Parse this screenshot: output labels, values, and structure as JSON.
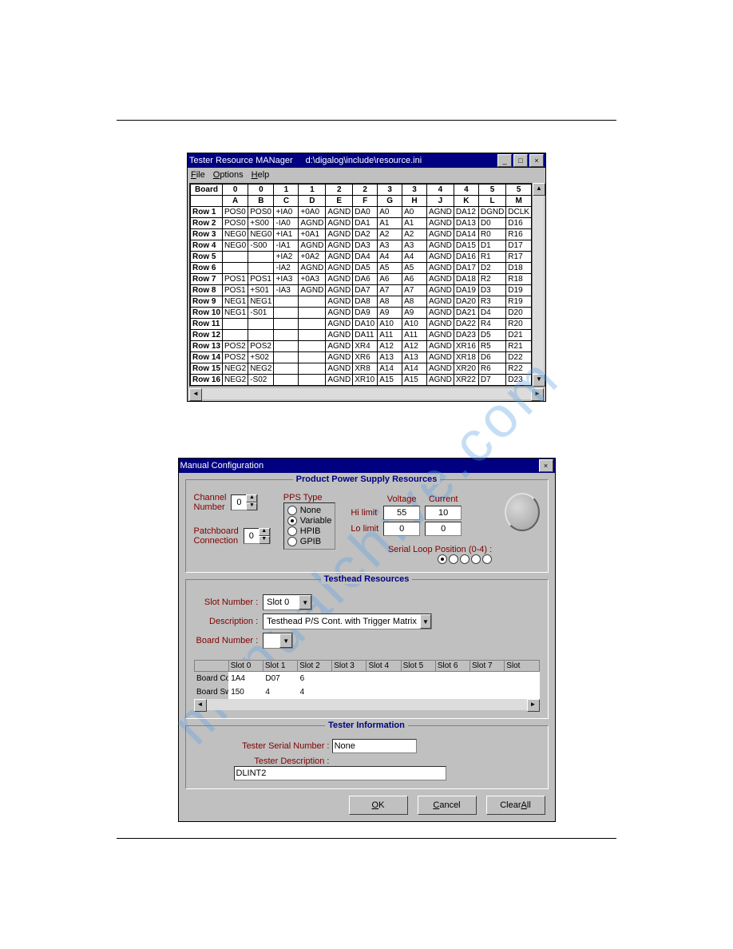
{
  "win1": {
    "title_app": "Tester Resource MANager",
    "title_path": "d:\\digalog\\include\\resource.ini",
    "menus": [
      "File",
      "Options",
      "Help"
    ],
    "header1": [
      "Board",
      "0",
      "0",
      "1",
      "1",
      "2",
      "2",
      "3",
      "3",
      "4",
      "4",
      "5",
      "5"
    ],
    "header2": [
      "",
      "A",
      "B",
      "C",
      "D",
      "E",
      "F",
      "G",
      "H",
      "J",
      "K",
      "L",
      "M"
    ],
    "rows": [
      [
        "Row 1",
        "POS0",
        "POS0",
        "+IA0",
        "+0A0",
        "AGND",
        "DA0",
        "A0",
        "A0",
        "AGND",
        "DA12",
        "DGND",
        "DCLK"
      ],
      [
        "Row 2",
        "POS0",
        "+S00",
        "-IA0",
        "AGND",
        "AGND",
        "DA1",
        "A1",
        "A1",
        "AGND",
        "DA13",
        "D0",
        "D16"
      ],
      [
        "Row 3",
        "NEG0",
        "NEG0",
        "+IA1",
        "+0A1",
        "AGND",
        "DA2",
        "A2",
        "A2",
        "AGND",
        "DA14",
        "R0",
        "R16"
      ],
      [
        "Row 4",
        "NEG0",
        "-S00",
        "-IA1",
        "AGND",
        "AGND",
        "DA3",
        "A3",
        "A3",
        "AGND",
        "DA15",
        "D1",
        "D17"
      ],
      [
        "Row 5",
        "",
        "",
        "+IA2",
        "+0A2",
        "AGND",
        "DA4",
        "A4",
        "A4",
        "AGND",
        "DA16",
        "R1",
        "R17"
      ],
      [
        "Row 6",
        "",
        "",
        "-IA2",
        "AGND",
        "AGND",
        "DA5",
        "A5",
        "A5",
        "AGND",
        "DA17",
        "D2",
        "D18"
      ],
      [
        "Row 7",
        "POS1",
        "POS1",
        "+IA3",
        "+0A3",
        "AGND",
        "DA6",
        "A6",
        "A6",
        "AGND",
        "DA18",
        "R2",
        "R18"
      ],
      [
        "Row 8",
        "POS1",
        "+S01",
        "-IA3",
        "AGND",
        "AGND",
        "DA7",
        "A7",
        "A7",
        "AGND",
        "DA19",
        "D3",
        "D19"
      ],
      [
        "Row 9",
        "NEG1",
        "NEG1",
        "",
        "",
        "AGND",
        "DA8",
        "A8",
        "A8",
        "AGND",
        "DA20",
        "R3",
        "R19"
      ],
      [
        "Row 10",
        "NEG1",
        "-S01",
        "",
        "",
        "AGND",
        "DA9",
        "A9",
        "A9",
        "AGND",
        "DA21",
        "D4",
        "D20"
      ],
      [
        "Row 11",
        "",
        "",
        "",
        "",
        "AGND",
        "DA10",
        "A10",
        "A10",
        "AGND",
        "DA22",
        "R4",
        "R20"
      ],
      [
        "Row 12",
        "",
        "",
        "",
        "",
        "AGND",
        "DA11",
        "A11",
        "A11",
        "AGND",
        "DA23",
        "D5",
        "D21"
      ],
      [
        "Row 13",
        "POS2",
        "POS2",
        "",
        "",
        "AGND",
        "XR4",
        "A12",
        "A12",
        "AGND",
        "XR16",
        "R5",
        "R21"
      ],
      [
        "Row 14",
        "POS2",
        "+S02",
        "",
        "",
        "AGND",
        "XR6",
        "A13",
        "A13",
        "AGND",
        "XR18",
        "D6",
        "D22"
      ],
      [
        "Row 15",
        "NEG2",
        "NEG2",
        "",
        "",
        "AGND",
        "XR8",
        "A14",
        "A14",
        "AGND",
        "XR20",
        "R6",
        "R22"
      ],
      [
        "Row 16",
        "NEG2",
        "-S02",
        "",
        "",
        "AGND",
        "XR10",
        "A15",
        "A15",
        "AGND",
        "XR22",
        "D7",
        "D23"
      ]
    ]
  },
  "win2": {
    "title": "Manual Configuration",
    "pps": {
      "group_title": "Product Power Supply Resources",
      "channel_label": "Channel\nNumber",
      "channel_val": "0",
      "patch_label": "Patchboard\nConnection",
      "patch_val": "0",
      "pps_type_label": "PPS Type",
      "radios": [
        "None",
        "Variable",
        "HPIB",
        "GPIB"
      ],
      "selected_radio": 1,
      "hi_label": "Hi limit",
      "lo_label": "Lo limit",
      "volt_label": "Voltage",
      "curr_label": "Current",
      "hi_volt": "55",
      "hi_curr": "10",
      "lo_volt": "0",
      "lo_curr": "0",
      "loop_label": "Serial Loop Position (0-4) :",
      "loop_selected": 0
    },
    "th": {
      "group_title": "Testhead Resources",
      "slot_label": "Slot Number :",
      "slot_val": "Slot 0",
      "desc_label": "Description :",
      "desc_val": "Testhead P/S Cont. with Trigger Matrix",
      "board_label": "Board Number :",
      "board_val": "",
      "slot_headers": [
        "",
        "Slot 0",
        "Slot 1",
        "Slot 2",
        "Slot 3",
        "Slot 4",
        "Slot 5",
        "Slot 6",
        "Slot 7",
        "Slot"
      ],
      "slot_rows": [
        [
          "Board Code",
          "1A4",
          "D07",
          "6",
          "",
          "",
          "",
          "",
          "",
          ""
        ],
        [
          "Board Switches",
          "150",
          "4",
          "4",
          "",
          "",
          "",
          "",
          "",
          ""
        ]
      ]
    },
    "ti": {
      "group_title": "Tester Information",
      "serial_label": "Tester Serial Number :",
      "serial_val": "None",
      "desc_label": "Tester Description :",
      "desc_val": "DLINT2"
    },
    "buttons": {
      "ok": "OK",
      "cancel": "Cancel",
      "clear": "Clear All"
    }
  },
  "watermark": "manualchive.com"
}
